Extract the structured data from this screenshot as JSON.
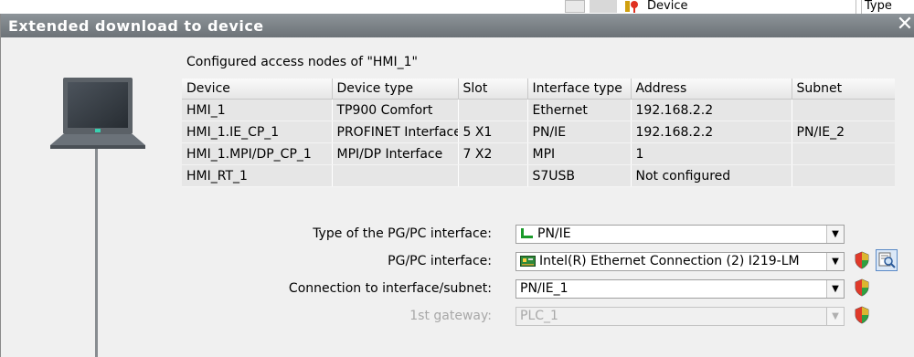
{
  "background_window": {
    "columns": [
      "Device",
      "Type"
    ]
  },
  "dialog": {
    "title": "Extended download to device",
    "close_glyph": "✕"
  },
  "nodes_section": {
    "title": "Configured access nodes of \"HMI_1\"",
    "columns": [
      "Device",
      "Device type",
      "Slot",
      "Interface type",
      "Address",
      "Subnet"
    ],
    "rows": [
      [
        "HMI_1",
        "TP900 Comfort",
        "",
        "Ethernet",
        "192.168.2.2",
        ""
      ],
      [
        "HMI_1.IE_CP_1",
        "PROFINET Interface",
        "5 X1",
        "PN/IE",
        "192.168.2.2",
        "PN/IE_2"
      ],
      [
        "HMI_1.MPI/DP_CP_1",
        "MPI/DP Interface",
        "7 X2",
        "MPI",
        "1",
        ""
      ],
      [
        "HMI_RT_1",
        "",
        "",
        "S7USB",
        "Not configured",
        ""
      ]
    ]
  },
  "form": {
    "pgpc_type_label": "Type of the PG/PC interface:",
    "pgpc_type_value": "PN/IE",
    "pgpc_interface_label": "PG/PC interface:",
    "pgpc_interface_value": "Intel(R) Ethernet Connection (2) I219-LM",
    "connection_label": "Connection to interface/subnet:",
    "connection_value": "PN/IE_1",
    "gateway_label": "1st gateway:",
    "gateway_value": "PLC_1"
  },
  "icons": {
    "device": "hmi-panel-icon",
    "pnie": "network-plug-icon",
    "nic": "network-card-icon",
    "shield": "shield-icon",
    "diagnostics": "magnifier-diagnostics-icon"
  },
  "colors": {
    "titlebar": "#7b8287",
    "table_row_bg": "#e6e6e6",
    "disabled_text": "#a8a8a8"
  }
}
